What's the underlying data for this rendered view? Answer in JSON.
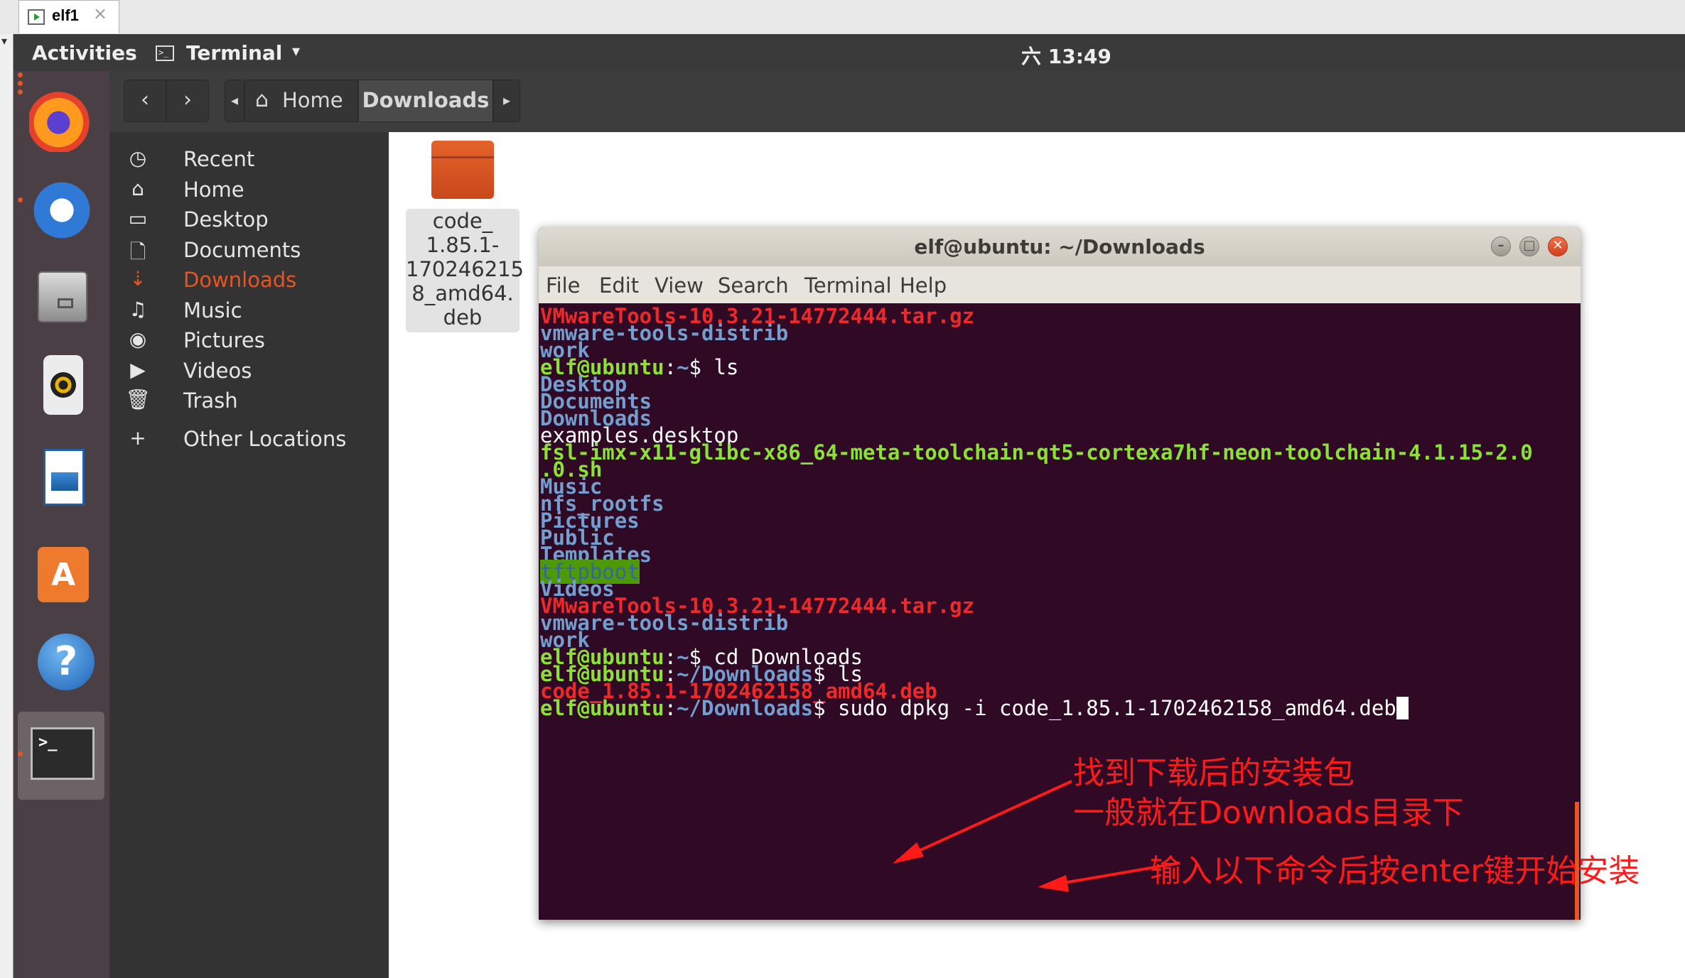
{
  "vm_tab": {
    "title": "elf1",
    "close": "×"
  },
  "top_bar": {
    "activities": "Activities",
    "app_menu": "Terminal",
    "app_menu_arrow": "▾",
    "clock": "六 13:49"
  },
  "dock": {
    "items": [
      {
        "name": "Firefox",
        "icon": "firefox-icon"
      },
      {
        "name": "Thunderbird",
        "icon": "thunderbird-icon"
      },
      {
        "name": "Files",
        "icon": "files-icon"
      },
      {
        "name": "Rhythmbox",
        "icon": "rhythmbox-icon"
      },
      {
        "name": "LibreOffice Writer",
        "icon": "writer-icon"
      },
      {
        "name": "Ubuntu Software",
        "icon": "software-store-icon",
        "glyph": "A"
      },
      {
        "name": "Help",
        "icon": "help-icon",
        "glyph": "?"
      },
      {
        "name": "Terminal",
        "icon": "terminal-icon",
        "glyph": ">_"
      }
    ]
  },
  "nautilus": {
    "header": {
      "back": "‹",
      "forward": "›",
      "crumb_left": "◂",
      "home_icon": "⌂",
      "home_label": "Home",
      "current_label": "Downloads",
      "crumb_right": "▸"
    },
    "sidebar": [
      {
        "label": "Recent",
        "icon": "◷",
        "icon_name": "recent-icon"
      },
      {
        "label": "Home",
        "icon": "⌂",
        "icon_name": "home-icon"
      },
      {
        "label": "Desktop",
        "icon": "▭",
        "icon_name": "desktop-folder-icon"
      },
      {
        "label": "Documents",
        "icon": "🗋",
        "icon_name": "documents-icon"
      },
      {
        "label": "Downloads",
        "icon": "⇣",
        "icon_name": "downloads-icon",
        "active": true
      },
      {
        "label": "Music",
        "icon": "♫",
        "icon_name": "music-icon"
      },
      {
        "label": "Pictures",
        "icon": "◉",
        "icon_name": "pictures-icon"
      },
      {
        "label": "Videos",
        "icon": "▶",
        "icon_name": "videos-icon"
      },
      {
        "label": "Trash",
        "icon": "🗑",
        "icon_name": "trash-icon"
      },
      {
        "label": "Other Locations",
        "icon": "+",
        "icon_name": "other-locations-icon"
      }
    ],
    "files": [
      {
        "name_lines": [
          "code_",
          "1.85.1-",
          "170246215",
          "8_amd64.",
          "deb"
        ],
        "icon": "deb-package-icon"
      }
    ]
  },
  "terminal": {
    "title": "elf@ubuntu: ~/Downloads",
    "window_buttons": {
      "minimize": "–",
      "maximize": "□",
      "close": "✕"
    },
    "menu": [
      "File",
      "Edit",
      "View",
      "Search",
      "Terminal",
      "Help"
    ],
    "lines": [
      [
        {
          "t": "VMwareTools-10.3.21-14772444.tar.gz",
          "c": "red"
        }
      ],
      [
        {
          "t": "vmware-tools-distrib",
          "c": "blue"
        }
      ],
      [
        {
          "t": "work",
          "c": "blue"
        }
      ],
      [
        {
          "t": "elf@ubuntu",
          "c": "user"
        },
        {
          "t": ":",
          "c": "white"
        },
        {
          "t": "~",
          "c": "path"
        },
        {
          "t": "$ ls",
          "c": "white"
        }
      ],
      [
        {
          "t": "Desktop",
          "c": "blue"
        }
      ],
      [
        {
          "t": "Documents",
          "c": "blue"
        }
      ],
      [
        {
          "t": "Downloads",
          "c": "blue"
        }
      ],
      [
        {
          "t": "examples.desktop",
          "c": "white"
        }
      ],
      [
        {
          "t": "fsl-imx-x11-glibc-x86_64-meta-toolchain-qt5-cortexa7hf-neon-toolchain-4.1.15-2.0",
          "c": "green"
        }
      ],
      [
        {
          "t": ".0.sh",
          "c": "green"
        }
      ],
      [
        {
          "t": "Music",
          "c": "blue"
        }
      ],
      [
        {
          "t": "nfs_rootfs",
          "c": "blue"
        }
      ],
      [
        {
          "t": "Pictures",
          "c": "blue"
        }
      ],
      [
        {
          "t": "Public",
          "c": "blue"
        }
      ],
      [
        {
          "t": "Templates",
          "c": "blue"
        }
      ],
      [
        {
          "t": "tftpboot",
          "c": "hl"
        }
      ],
      [
        {
          "t": "Videos",
          "c": "blue"
        }
      ],
      [
        {
          "t": "VMwareTools-10.3.21-14772444.tar.gz",
          "c": "red"
        }
      ],
      [
        {
          "t": "vmware-tools-distrib",
          "c": "blue"
        }
      ],
      [
        {
          "t": "work",
          "c": "blue"
        }
      ],
      [
        {
          "t": "elf@ubuntu",
          "c": "user"
        },
        {
          "t": ":",
          "c": "white"
        },
        {
          "t": "~",
          "c": "path"
        },
        {
          "t": "$ cd Downloads",
          "c": "white"
        }
      ],
      [
        {
          "t": "elf@ubuntu",
          "c": "user"
        },
        {
          "t": ":",
          "c": "white"
        },
        {
          "t": "~/Downloads",
          "c": "path"
        },
        {
          "t": "$ ls",
          "c": "white"
        }
      ],
      [
        {
          "t": "code_1.85.1-1702462158_amd64.deb",
          "c": "red"
        }
      ],
      [
        {
          "t": "elf@ubuntu",
          "c": "user"
        },
        {
          "t": ":",
          "c": "white"
        },
        {
          "t": "~/Downloads",
          "c": "path"
        },
        {
          "t": "$ sudo dpkg -i code_1.85.1-1702462158_amd64.deb",
          "c": "white"
        },
        {
          "t": "",
          "c": "cursor"
        }
      ]
    ]
  },
  "annotations": {
    "note1_line1": "找到下载后的安装包",
    "note1_line2": "一般就在Downloads目录下",
    "note2": "输入以下命令后按enter键开始安装",
    "color": "#ff1a1a"
  }
}
